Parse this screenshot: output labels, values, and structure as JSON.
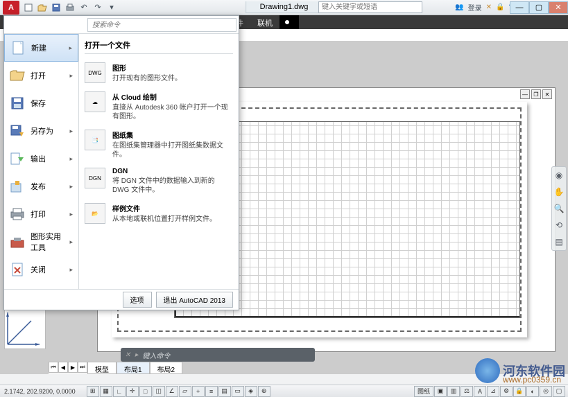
{
  "title": "Drawing1.dwg",
  "search_placeholder": "键入关键字或短语",
  "login_label": "登录",
  "ribbon": {
    "tab1": "件",
    "tab2": "联机"
  },
  "app_menu": {
    "search_placeholder": "搜索命令",
    "side": [
      {
        "label": "新建"
      },
      {
        "label": "打开"
      },
      {
        "label": "保存"
      },
      {
        "label": "另存为"
      },
      {
        "label": "输出"
      },
      {
        "label": "发布"
      },
      {
        "label": "打印"
      },
      {
        "label": "图形实用工具"
      },
      {
        "label": "关闭"
      }
    ],
    "detail_head": "打开一个文件",
    "detail": [
      {
        "title": "图形",
        "desc": "打开现有的图形文件。",
        "badge": "DWG"
      },
      {
        "title": "从 Cloud 绘制",
        "desc": "直接从 Autodesk 360 帐户打开一个现有图形。",
        "badge": "☁"
      },
      {
        "title": "图纸集",
        "desc": "在图纸集管理器中打开图纸集数据文件。",
        "badge": "📑"
      },
      {
        "title": "DGN",
        "desc": "将 DGN 文件中的数据输入到新的 DWG 文件中。",
        "badge": "DGN"
      },
      {
        "title": "样例文件",
        "desc": "从本地或联机位置打开样例文件。",
        "badge": "📂"
      }
    ],
    "footer": {
      "options": "选项",
      "exit": "退出 AutoCAD 2013"
    }
  },
  "layout_tabs": {
    "t1": "模型",
    "t2": "布局1",
    "t3": "布局2"
  },
  "cmdline_placeholder": "键入命令",
  "status": {
    "coords": "2.1742, 202.9200, 0.0000",
    "right_label": "图纸"
  },
  "watermark": {
    "text": "河东软件园",
    "url": "www.pc0359.cn"
  }
}
